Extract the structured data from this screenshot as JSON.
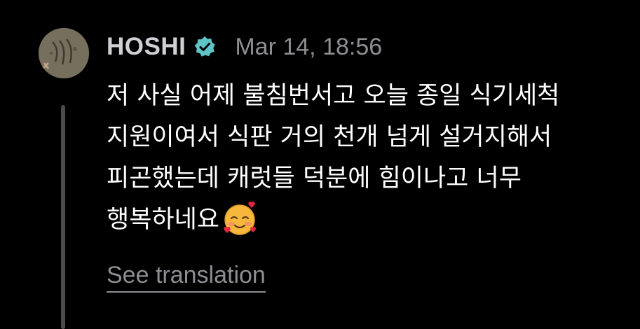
{
  "post": {
    "author": {
      "name": "HOSHI",
      "verified_icon": "verified-badge-icon",
      "avatar_icon": "avatar-photo"
    },
    "timestamp": "Mar 14, 18:56",
    "message_lines": [
      "저 사실 어제 불침번서고 오늘 종일 식기세척",
      "지원이여서 식판 거의 천개 넘게 설거지해서",
      "피곤했는데 캐럿들 덕분에 힘이나고 너무",
      "행복하네요"
    ],
    "emoji": "smiling-face-with-hearts-icon",
    "translate_label": "See translation"
  },
  "colors": {
    "background": "#000000",
    "username": "#cfcfd6",
    "muted": "#8e8e93",
    "verified_badge": "#5ec4c8",
    "thread_line": "#4b4b4d"
  }
}
